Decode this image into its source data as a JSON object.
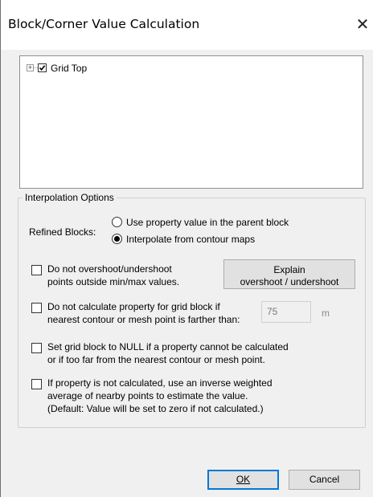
{
  "dialog": {
    "title": "Block/Corner Value Calculation",
    "close_glyph": "✕"
  },
  "tree": {
    "expander": "+",
    "checked": true,
    "item_label": "Grid Top"
  },
  "interpolation": {
    "group_title": "Interpolation Options",
    "refined_label": "Refined Blocks:",
    "radio_options": [
      {
        "label": "Use property value in the parent block",
        "selected": false
      },
      {
        "label": "Interpolate from contour maps",
        "selected": true
      }
    ],
    "option1": {
      "line1": "Do not overshoot/undershoot",
      "line2": "points outside min/max values.",
      "checked": false
    },
    "explain_button": {
      "line1": "Explain",
      "line2": "overshoot / undershoot"
    },
    "option2": {
      "line1": "Do not calculate property for grid block if",
      "line2": "nearest contour or mesh point is farther than:",
      "checked": false,
      "value": "75",
      "unit": "m"
    },
    "option3": {
      "line1": "Set grid block to NULL if a property cannot be calculated",
      "line2": "or if too far from the nearest contour or mesh point.",
      "checked": false
    },
    "option4": {
      "line1": "If property is not calculated, use an inverse weighted",
      "line2": "average of nearby points to estimate the value.",
      "line3": "(Default: Value will be set to zero if not calculated.)",
      "checked": false
    }
  },
  "buttons": {
    "ok": "OK",
    "cancel": "Cancel"
  }
}
